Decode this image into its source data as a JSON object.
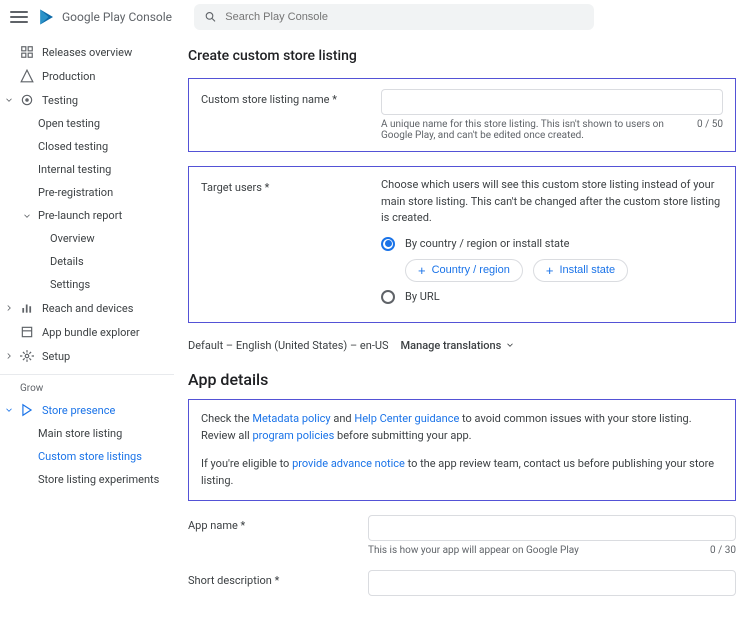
{
  "header": {
    "logo_text": "Google Play Console",
    "search_placeholder": "Search Play Console"
  },
  "sidebar": {
    "items": {
      "releases_overview": "Releases overview",
      "production": "Production",
      "testing": "Testing",
      "open_testing": "Open testing",
      "closed_testing": "Closed testing",
      "internal_testing": "Internal testing",
      "pre_registration": "Pre-registration",
      "pre_launch_report": "Pre-launch report",
      "overview": "Overview",
      "details": "Details",
      "settings": "Settings",
      "reach_devices": "Reach and devices",
      "app_bundle": "App bundle explorer",
      "setup": "Setup",
      "grow_label": "Grow",
      "store_presence": "Store presence",
      "main_store_listing": "Main store listing",
      "custom_store_listings": "Custom store listings",
      "store_listing_experiments": "Store listing experiments"
    }
  },
  "main": {
    "page_title": "Create custom store listing",
    "csl_name_label": "Custom store listing name  *",
    "csl_name_hint": "A unique name for this store listing. This isn't shown to users on Google Play, and can't be edited once created.",
    "csl_name_counter": "0 / 50",
    "target_users_label": "Target users  *",
    "target_users_desc": "Choose which users will see this custom store listing instead of your main store listing. This can't be changed after the custom store listing is created.",
    "by_country_label": "By country / region or install state",
    "country_chip": "Country / region",
    "install_chip": "Install state",
    "by_url_label": "By URL",
    "default_lang": "Default – English (United States) – en-US",
    "manage_translations": "Manage translations",
    "app_details_heading": "App details",
    "notice_part1": "Check the ",
    "notice_link1": "Metadata policy",
    "notice_part2": " and ",
    "notice_link2": "Help Center guidance",
    "notice_part3": " to avoid common issues with your store listing. Review all ",
    "notice_link3": "program policies",
    "notice_part4": " before submitting your app.",
    "notice_part5": "If you're eligible to ",
    "notice_link4": "provide advance notice",
    "notice_part6": " to the app review team, contact us before publishing your store listing.",
    "app_name_label": "App name  *",
    "app_name_hint": "This is how your app will appear on Google Play",
    "app_name_counter": "0 / 30",
    "short_desc_label": "Short description  *"
  }
}
